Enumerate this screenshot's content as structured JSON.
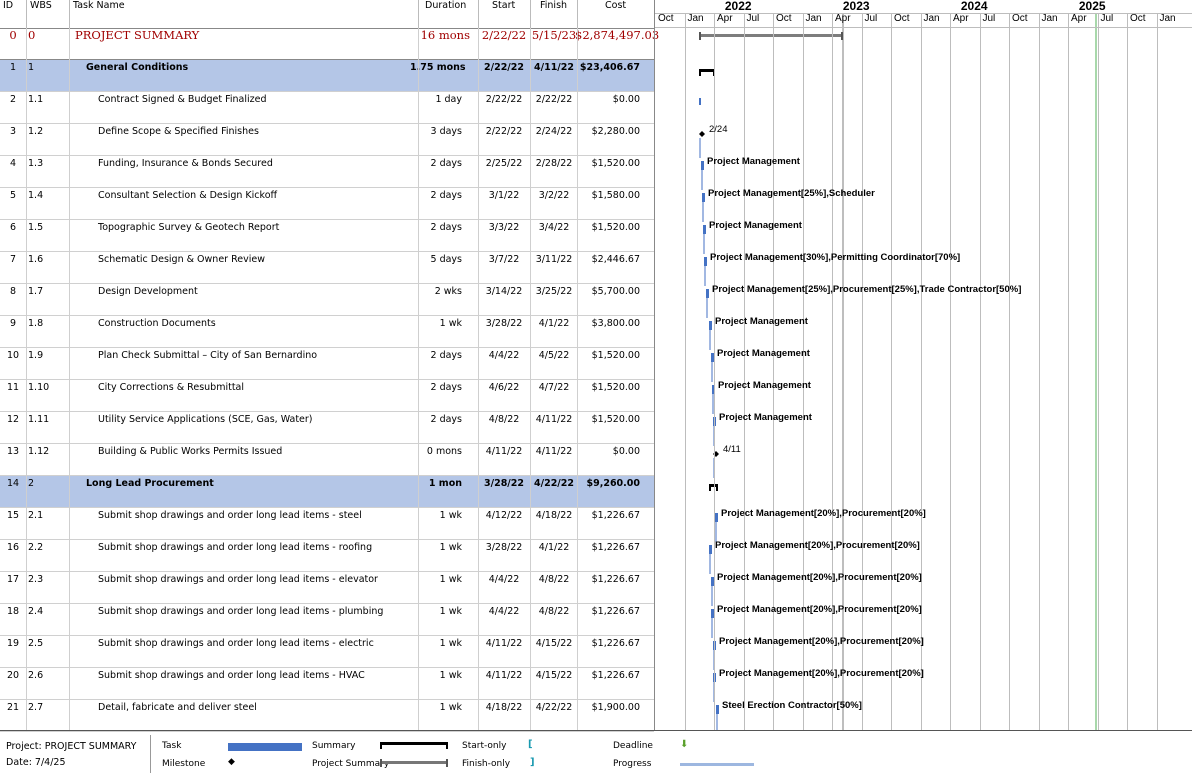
{
  "columns": {
    "id": "ID",
    "wbs": "WBS",
    "name": "Task Name",
    "duration": "Duration",
    "start": "Start",
    "finish": "Finish",
    "cost": "Cost"
  },
  "timescale": {
    "years": [
      "2022",
      "2023",
      "2024",
      "2025"
    ],
    "months": [
      "Oct",
      "Jan",
      "Apr",
      "Jul",
      "Oct",
      "Jan",
      "Apr",
      "Jul",
      "Oct",
      "Jan",
      "Apr",
      "Jul",
      "Oct",
      "Jan",
      "Apr",
      "Jul",
      "Oct",
      "Jan"
    ]
  },
  "tasks": [
    {
      "id": "0",
      "wbs": "0",
      "name": "PROJECT SUMMARY",
      "duration": "16 mons",
      "start": "2/22/22",
      "finish": "5/15/23",
      "cost": "$2,874,497.03",
      "kind": "project"
    },
    {
      "id": "1",
      "wbs": "1",
      "name": "General Conditions",
      "duration": "1.75 mons",
      "start": "2/22/22",
      "finish": "4/11/22",
      "cost": "$23,406.67",
      "kind": "summary"
    },
    {
      "id": "2",
      "wbs": "1.1",
      "name": "Contract Signed & Budget Finalized",
      "duration": "1 day",
      "start": "2/22/22",
      "finish": "2/22/22",
      "cost": "$0.00",
      "kind": "task"
    },
    {
      "id": "3",
      "wbs": "1.2",
      "name": "Define Scope & Specified Finishes",
      "duration": "3 days",
      "start": "2/22/22",
      "finish": "2/24/22",
      "cost": "$2,280.00",
      "kind": "task"
    },
    {
      "id": "4",
      "wbs": "1.3",
      "name": "Funding, Insurance & Bonds Secured",
      "duration": "2 days",
      "start": "2/25/22",
      "finish": "2/28/22",
      "cost": "$1,520.00",
      "kind": "task"
    },
    {
      "id": "5",
      "wbs": "1.4",
      "name": "Consultant Selection & Design Kickoff",
      "duration": "2 days",
      "start": "3/1/22",
      "finish": "3/2/22",
      "cost": "$1,580.00",
      "kind": "task"
    },
    {
      "id": "6",
      "wbs": "1.5",
      "name": "Topographic Survey & Geotech Report",
      "duration": "2 days",
      "start": "3/3/22",
      "finish": "3/4/22",
      "cost": "$1,520.00",
      "kind": "task"
    },
    {
      "id": "7",
      "wbs": "1.6",
      "name": "Schematic Design & Owner Review",
      "duration": "5 days",
      "start": "3/7/22",
      "finish": "3/11/22",
      "cost": "$2,446.67",
      "kind": "task"
    },
    {
      "id": "8",
      "wbs": "1.7",
      "name": "Design Development",
      "duration": "2 wks",
      "start": "3/14/22",
      "finish": "3/25/22",
      "cost": "$5,700.00",
      "kind": "task"
    },
    {
      "id": "9",
      "wbs": "1.8",
      "name": "Construction Documents",
      "duration": "1 wk",
      "start": "3/28/22",
      "finish": "4/1/22",
      "cost": "$3,800.00",
      "kind": "task"
    },
    {
      "id": "10",
      "wbs": "1.9",
      "name": "Plan Check Submittal – City of San Bernardino",
      "duration": "2 days",
      "start": "4/4/22",
      "finish": "4/5/22",
      "cost": "$1,520.00",
      "kind": "task"
    },
    {
      "id": "11",
      "wbs": "1.10",
      "name": "City Corrections & Resubmittal",
      "duration": "2 days",
      "start": "4/6/22",
      "finish": "4/7/22",
      "cost": "$1,520.00",
      "kind": "task"
    },
    {
      "id": "12",
      "wbs": "1.11",
      "name": "Utility Service Applications (SCE, Gas, Water)",
      "duration": "2 days",
      "start": "4/8/22",
      "finish": "4/11/22",
      "cost": "$1,520.00",
      "kind": "task"
    },
    {
      "id": "13",
      "wbs": "1.12",
      "name": "Building & Public Works Permits Issued",
      "duration": "0 mons",
      "start": "4/11/22",
      "finish": "4/11/22",
      "cost": "$0.00",
      "kind": "task"
    },
    {
      "id": "14",
      "wbs": "2",
      "name": "Long Lead Procurement",
      "duration": "1 mon",
      "start": "3/28/22",
      "finish": "4/22/22",
      "cost": "$9,260.00",
      "kind": "summary"
    },
    {
      "id": "15",
      "wbs": "2.1",
      "name": "Submit shop drawings and order long lead items - steel",
      "duration": "1 wk",
      "start": "4/12/22",
      "finish": "4/18/22",
      "cost": "$1,226.67",
      "kind": "task"
    },
    {
      "id": "16",
      "wbs": "2.2",
      "name": "Submit shop drawings and order long lead items - roofing",
      "duration": "1 wk",
      "start": "3/28/22",
      "finish": "4/1/22",
      "cost": "$1,226.67",
      "kind": "task"
    },
    {
      "id": "17",
      "wbs": "2.3",
      "name": "Submit shop drawings and order long lead items - elevator",
      "duration": "1 wk",
      "start": "4/4/22",
      "finish": "4/8/22",
      "cost": "$1,226.67",
      "kind": "task"
    },
    {
      "id": "18",
      "wbs": "2.4",
      "name": "Submit shop drawings and order long lead items - plumbing",
      "duration": "1 wk",
      "start": "4/4/22",
      "finish": "4/8/22",
      "cost": "$1,226.67",
      "kind": "task"
    },
    {
      "id": "19",
      "wbs": "2.5",
      "name": "Submit shop drawings and order long lead items - electric",
      "duration": "1 wk",
      "start": "4/11/22",
      "finish": "4/15/22",
      "cost": "$1,226.67",
      "kind": "task"
    },
    {
      "id": "20",
      "wbs": "2.6",
      "name": "Submit shop drawings and order long lead items - HVAC",
      "duration": "1 wk",
      "start": "4/11/22",
      "finish": "4/15/22",
      "cost": "$1,226.67",
      "kind": "task"
    },
    {
      "id": "21",
      "wbs": "2.7",
      "name": "Detail, fabricate and deliver steel",
      "duration": "1 wk",
      "start": "4/18/22",
      "finish": "4/22/22",
      "cost": "$1,900.00",
      "kind": "task"
    }
  ],
  "gantt_labels": [
    {
      "row": 3,
      "text": "2/24",
      "milestone": true
    },
    {
      "row": 4,
      "text": "Project Management"
    },
    {
      "row": 5,
      "text": "Project Management[25%],Scheduler"
    },
    {
      "row": 6,
      "text": "Project Management"
    },
    {
      "row": 7,
      "text": "Project Management[30%],Permitting Coordinator[70%]"
    },
    {
      "row": 8,
      "text": "Project Management[25%],Procurement[25%],Trade Contractor[50%]"
    },
    {
      "row": 9,
      "text": "Project Management"
    },
    {
      "row": 10,
      "text": "Project Management"
    },
    {
      "row": 11,
      "text": "Project Management"
    },
    {
      "row": 12,
      "text": "Project Management"
    },
    {
      "row": 13,
      "text": "4/11",
      "milestone": true
    },
    {
      "row": 15,
      "text": "Project Management[20%],Procurement[20%]"
    },
    {
      "row": 16,
      "text": "Project Management[20%],Procurement[20%]"
    },
    {
      "row": 17,
      "text": "Project Management[20%],Procurement[20%]"
    },
    {
      "row": 18,
      "text": "Project Management[20%],Procurement[20%]"
    },
    {
      "row": 19,
      "text": "Project Management[20%],Procurement[20%]"
    },
    {
      "row": 20,
      "text": "Project Management[20%],Procurement[20%]"
    },
    {
      "row": 21,
      "text": "Steel Erection Contractor[50%]"
    }
  ],
  "legend": {
    "project_line": "Project: PROJECT SUMMARY",
    "date_line": "Date: 7/4/25",
    "task": "Task",
    "milestone": "Milestone",
    "summary": "Summary",
    "project_summary": "Project Summary",
    "start_only": "Start-only",
    "finish_only": "Finish-only",
    "deadline": "Deadline",
    "progress": "Progress"
  },
  "colors": {
    "summary_row_bg": "#b4c6e7",
    "project_text": "#a00000",
    "task_bar": "#4472c4",
    "current_date_line": "#6fbf73",
    "progress": "#9db7e0"
  }
}
